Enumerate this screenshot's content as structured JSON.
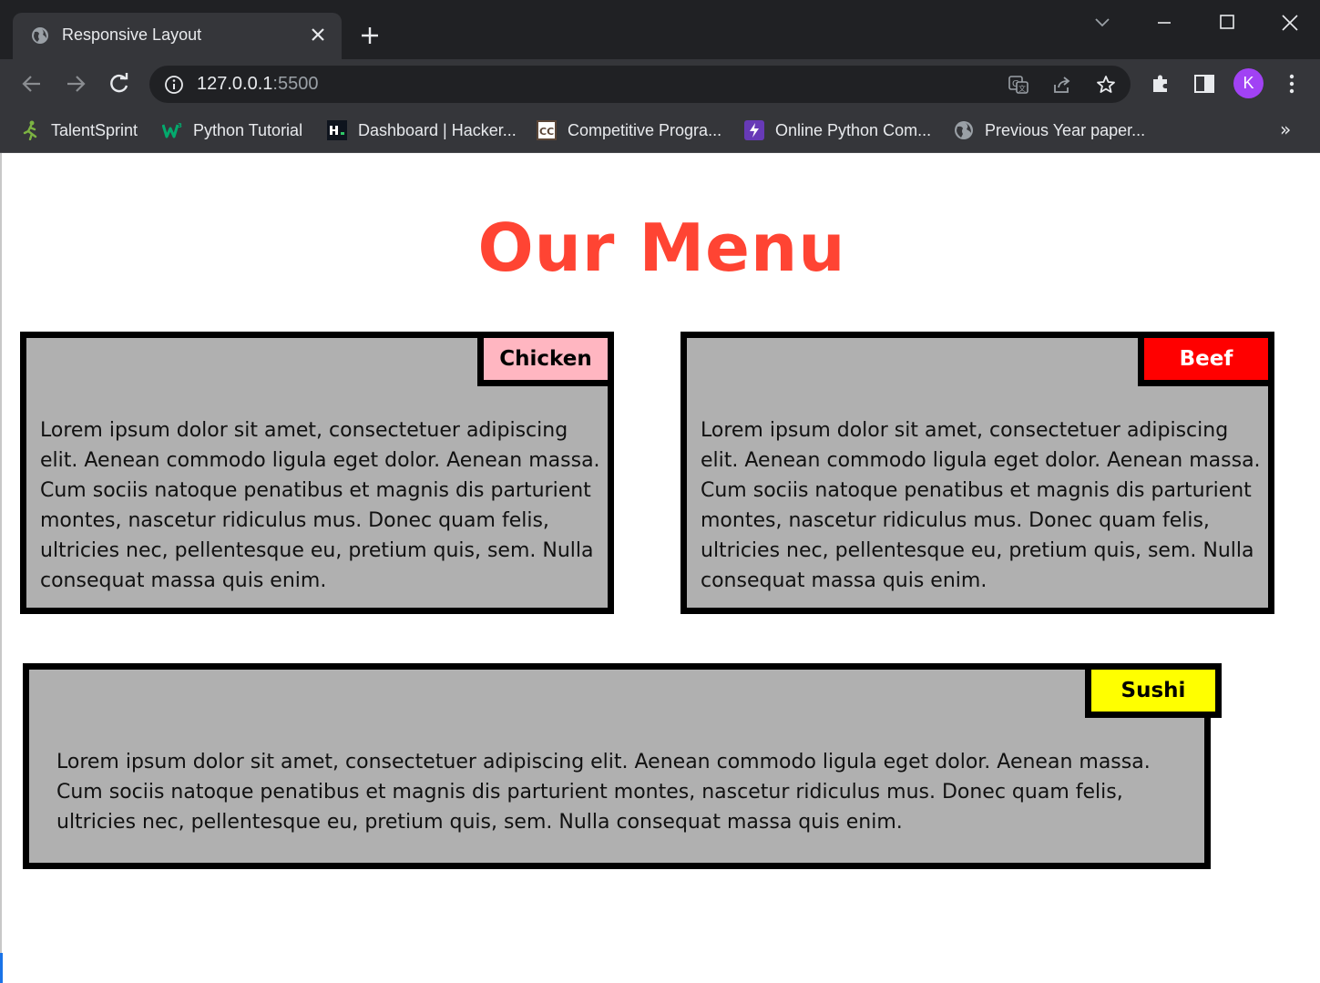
{
  "browser": {
    "tab": {
      "title": "Responsive Layout",
      "favicon": "globe-icon"
    },
    "url": {
      "host": "127.0.0.1",
      "port": ":5500"
    },
    "profile_initial": "K",
    "bookmarks": [
      {
        "label": "TalentSprint",
        "icon": "runner-icon"
      },
      {
        "label": "Python Tutorial",
        "icon": "w3schools-icon"
      },
      {
        "label": "Dashboard | Hacker...",
        "icon": "hackerrank-icon"
      },
      {
        "label": "Competitive Progra...",
        "icon": "codechef-icon"
      },
      {
        "label": "Online Python Com...",
        "icon": "bolt-icon"
      },
      {
        "label": "Previous Year paper...",
        "icon": "globe-icon"
      }
    ],
    "bookmarks_overflow": "»"
  },
  "page": {
    "heading": "Our Menu",
    "cards": [
      {
        "tag": "Chicken",
        "tag_color": "#ffb6c1",
        "text": "Lorem ipsum dolor sit amet, consectetuer adipiscing elit. Aenean commodo ligula eget dolor. Aenean massa. Cum sociis natoque penatibus et magnis dis parturient montes, nascetur ridiculus mus. Donec quam felis, ultricies nec, pellentesque eu, pretium quis, sem. Nulla consequat massa quis enim."
      },
      {
        "tag": "Beef",
        "tag_color": "#ff0000",
        "text": "Lorem ipsum dolor sit amet, consectetuer adipiscing elit. Aenean commodo ligula eget dolor. Aenean massa. Cum sociis natoque penatibus et magnis dis parturient montes, nascetur ridiculus mus. Donec quam felis, ultricies nec, pellentesque eu, pretium quis, sem. Nulla consequat massa quis enim."
      },
      {
        "tag": "Sushi",
        "tag_color": "#ffff00",
        "text": "Lorem ipsum dolor sit amet, consectetuer adipiscing elit. Aenean commodo ligula eget dolor. Aenean massa. Cum sociis natoque penatibus et magnis dis parturient montes, nascetur ridiculus mus. Donec quam felis, ultricies nec, pellentesque eu, pretium quis, sem. Nulla consequat massa quis enim."
      }
    ]
  },
  "colors": {
    "heading": "#ff4433",
    "card_background": "#b0b0b0",
    "card_border": "#000000",
    "chrome_dark": "#202124",
    "chrome_toolbar": "#35363a",
    "avatar": "#a142f4"
  }
}
